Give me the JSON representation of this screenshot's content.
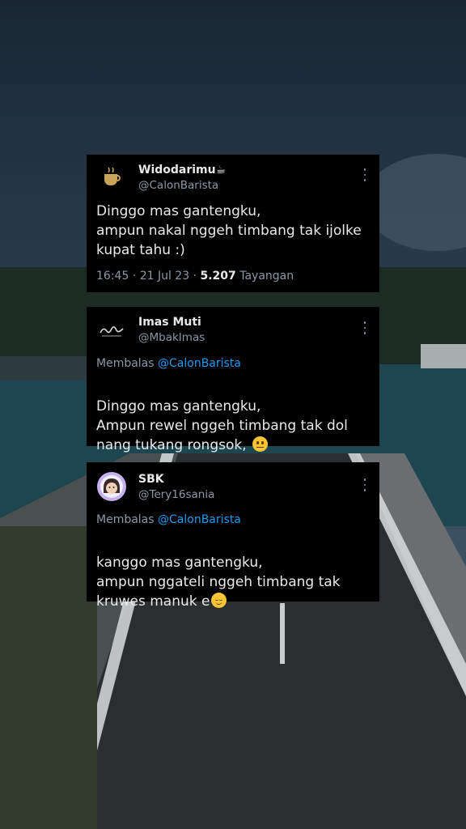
{
  "tweets": [
    {
      "name": "Widodarimu☕",
      "handle": "@CalonBarista",
      "text": "Dinggo mas gantengku,\nampun nakal nggeh timbang tak ijolke kupat tahu :)",
      "time": "16:45 · 21 Jul 23 · ",
      "views_count": "5.207",
      "views_label": " Tayangan",
      "avatar": "coffee-logo-avatar"
    },
    {
      "name": "Imas Muti",
      "handle": "@MbakImas",
      "reply_prefix": "Membalas ",
      "reply_mention": "@CalonBarista",
      "text": "Dinggo mas gantengku,\nAmpun rewel nggeh timbang tak dol nang tukang rongsok, ",
      "emoji": "neutral-face-emoji",
      "avatar": "script-logo-avatar"
    },
    {
      "name": "SBK",
      "handle": "@Tery16sania",
      "reply_prefix": "Membalas ",
      "reply_mention": "@CalonBarista",
      "text": "kanggo mas gantengku,\nampun nggateli nggeh timbang tak kruwes manuk e",
      "emoji": "relieved-face-emoji",
      "avatar": "cartoon-avatar"
    }
  ],
  "colors": {
    "card_bg": "#000000",
    "text": "#e7e9ea",
    "muted": "#8b98a5",
    "mention": "#1d9bf0"
  }
}
